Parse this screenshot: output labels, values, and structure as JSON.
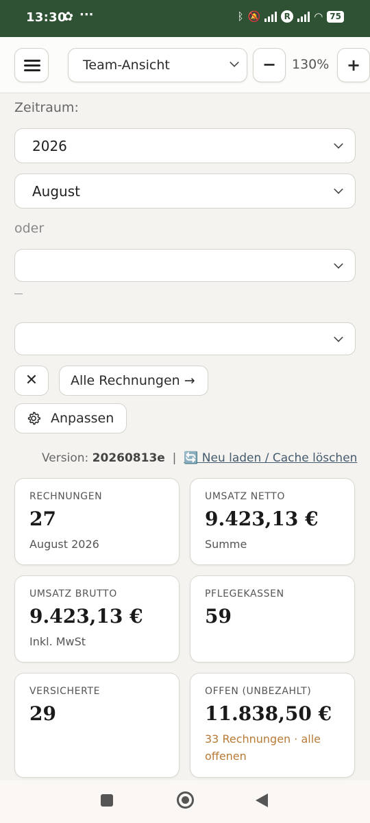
{
  "status_bar": {
    "time": "13:30",
    "battery": "75",
    "network_badge": "R",
    "icons": [
      "leaf-icon",
      "more-icon",
      "bluetooth-icon",
      "mute-icon",
      "signal-icon",
      "wifi-icon",
      "battery-icon"
    ]
  },
  "toolbar": {
    "view_select": "Team-Ansicht",
    "zoom_minus": "−",
    "zoom_level": "130%",
    "zoom_plus": "+"
  },
  "filters": {
    "period_label": "Zeitraum:",
    "year_select": "2026",
    "month_select": "August",
    "or_label": "oder",
    "range_separator": "–",
    "range_from": "",
    "range_to": "",
    "clear_label": "✕",
    "all_invoices_label": "Alle Rechnungen →",
    "customize_label": "Anpassen"
  },
  "version": {
    "prefix": "Version:",
    "value": "20260813e",
    "separator": "|",
    "reload_icon": "🔄",
    "reload_label": "Neu laden / Cache löschen"
  },
  "stats": [
    {
      "label": "RECHNUNGEN",
      "value": "27",
      "sub": "August 2026"
    },
    {
      "label": "UMSATZ NETTO",
      "value": "9.423,13 €",
      "sub": "Summe"
    },
    {
      "label": "UMSATZ BRUTTO",
      "value": "9.423,13 €",
      "sub": "Inkl. MwSt"
    },
    {
      "label": "PFLEGEKASSEN",
      "value": "59",
      "sub": ""
    },
    {
      "label": "VERSICHERTE",
      "value": "29",
      "sub": ""
    },
    {
      "label": "OFFEN (UNBEZAHLT)",
      "value": "11.838,50 €",
      "sub": "33 Rechnungen · alle offenen"
    }
  ],
  "colors": {
    "header": "#2f5234",
    "warning": "#b87a37",
    "link": "#445b6f",
    "background": "#f4f3ef"
  }
}
